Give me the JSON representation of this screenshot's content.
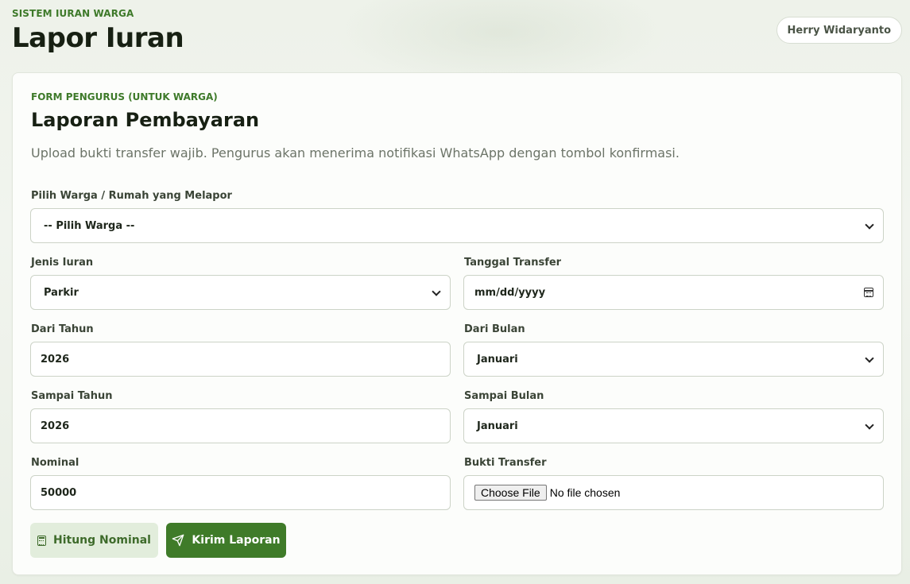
{
  "app": {
    "eyebrow": "SISTEM IURAN WARGA",
    "title": "Lapor Iuran",
    "user_name": "Herry Widaryanto"
  },
  "form": {
    "eyebrow": "FORM PENGURUS (UNTUK WARGA)",
    "title": "Laporan Pembayaran",
    "description": "Upload bukti transfer wajib. Pengurus akan menerima notifikasi WhatsApp dengan tombol konfirmasi.",
    "warga": {
      "label": "Pilih Warga / Rumah yang Melapor",
      "value": "-- Pilih Warga --"
    },
    "jenis_iuran": {
      "label": "Jenis Iuran",
      "value": "Parkir"
    },
    "tanggal_transfer": {
      "label": "Tanggal Transfer",
      "placeholder": "mm/dd/yyyy"
    },
    "dari_tahun": {
      "label": "Dari Tahun",
      "value": "2026"
    },
    "dari_bulan": {
      "label": "Dari Bulan",
      "value": "Januari"
    },
    "sampai_tahun": {
      "label": "Sampai Tahun",
      "value": "2026"
    },
    "sampai_bulan": {
      "label": "Sampai Bulan",
      "value": "Januari"
    },
    "nominal": {
      "label": "Nominal",
      "value": "50000"
    },
    "bukti_transfer": {
      "label": "Bukti Transfer",
      "button": "Choose File",
      "status": "No file chosen"
    },
    "buttons": {
      "hitung": "Hitung Nominal",
      "kirim": "Kirim Laporan"
    }
  },
  "colors": {
    "accent": "#3f7b29",
    "accent_light": "#e2eddc",
    "background": "#eef2ea"
  },
  "icons": {
    "hitung": "calculator-icon",
    "kirim": "send-icon",
    "select": "chevron-down-icon",
    "date": "calendar-icon"
  }
}
